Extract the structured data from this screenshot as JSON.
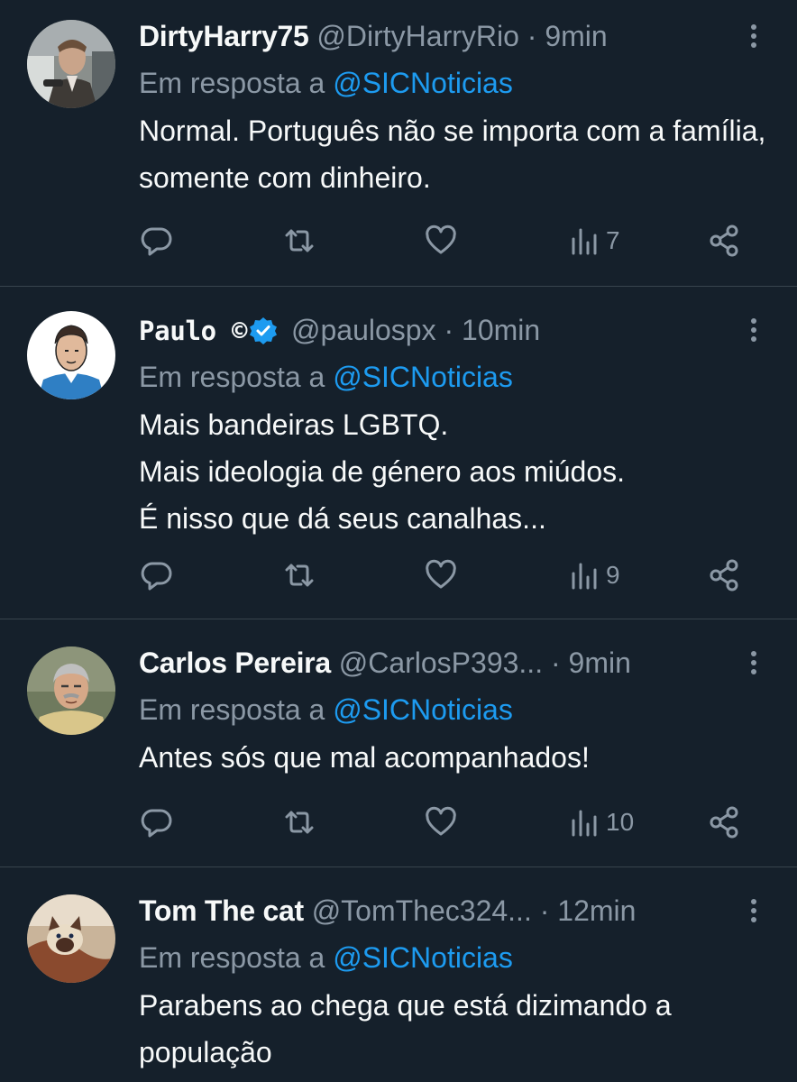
{
  "tweets": [
    {
      "name": "DirtyHarry75",
      "handle": "@DirtyHarryRio",
      "separator": "·",
      "time": "9min",
      "reply_prefix": "Em resposta a",
      "reply_mention": "@SICNoticias",
      "text": "Normal. Português não se importa com a família, somente com dinheiro.",
      "views": "7",
      "verified": false
    },
    {
      "name": "Paulo ©",
      "handle": "@paulospx",
      "separator": "·",
      "time": "10min",
      "reply_prefix": "Em resposta a",
      "reply_mention": "@SICNoticias",
      "text": "Mais bandeiras LGBTQ.\nMais ideologia de género aos miúdos.\nÉ nisso que dá seus canalhas...",
      "views": "9",
      "verified": true
    },
    {
      "name": "Carlos Pereira",
      "handle": "@CarlosP393...",
      "separator": "·",
      "time": "9min",
      "reply_prefix": "Em resposta a",
      "reply_mention": "@SICNoticias",
      "text": "Antes sós que mal acompanhados!",
      "views": "10",
      "verified": false
    },
    {
      "name": "Tom The cat",
      "handle": "@TomThec324...",
      "separator": "·",
      "time": "12min",
      "reply_prefix": "Em resposta a",
      "reply_mention": "@SICNoticias",
      "text": "Parabens ao chega que está dizimando a população",
      "verified": false
    }
  ],
  "icons": {
    "reply": "reply-icon",
    "retweet": "retweet-icon",
    "like": "like-icon",
    "views": "views-icon",
    "share": "share-icon",
    "more": "more-icon",
    "verified": "verified-badge-icon"
  },
  "colors": {
    "background": "#15202b",
    "text": "#f7f9f9",
    "secondary": "#8b98a5",
    "accent": "#1d9bf0",
    "divider": "#38444d"
  }
}
